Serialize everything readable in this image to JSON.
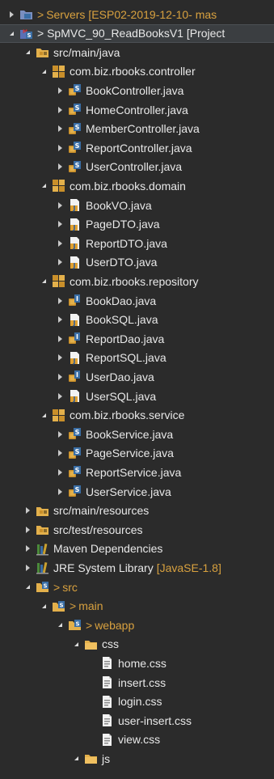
{
  "tree": [
    {
      "name": "servers-node",
      "depth": 0,
      "state": "closed",
      "icon": "project-folder-icon",
      "prefix": ">",
      "label": "Servers",
      "decoration": "[ESP02-2019-12-10- mas"
    },
    {
      "name": "project-node",
      "depth": 0,
      "state": "open",
      "icon": "maven-project-icon",
      "prefix": "",
      "label": "> SpMVC_90_ReadBooksV1 [Project",
      "decoration": "",
      "selected": true
    },
    {
      "name": "src-main-java",
      "depth": 1,
      "state": "open",
      "icon": "source-folder-icon",
      "prefix": "",
      "label": "src/main/java",
      "decoration": ""
    },
    {
      "name": "pkg-controller",
      "depth": 2,
      "state": "open",
      "icon": "package-icon",
      "prefix": "",
      "label": "com.biz.rbooks.controller",
      "decoration": ""
    },
    {
      "name": "file-bookcontroller",
      "depth": 3,
      "state": "closed",
      "icon": "java-class-icon",
      "prefix": "",
      "label": "BookController.java",
      "decoration": ""
    },
    {
      "name": "file-homecontroller",
      "depth": 3,
      "state": "closed",
      "icon": "java-class-icon",
      "prefix": "",
      "label": "HomeController.java",
      "decoration": ""
    },
    {
      "name": "file-membercontroller",
      "depth": 3,
      "state": "closed",
      "icon": "java-class-icon",
      "prefix": "",
      "label": "MemberController.java",
      "decoration": ""
    },
    {
      "name": "file-reportcontroller",
      "depth": 3,
      "state": "closed",
      "icon": "java-class-icon",
      "prefix": "",
      "label": "ReportController.java",
      "decoration": ""
    },
    {
      "name": "file-usercontroller",
      "depth": 3,
      "state": "closed",
      "icon": "java-class-icon",
      "prefix": "",
      "label": "UserController.java",
      "decoration": ""
    },
    {
      "name": "pkg-domain",
      "depth": 2,
      "state": "open",
      "icon": "package-icon",
      "prefix": "",
      "label": "com.biz.rbooks.domain",
      "decoration": ""
    },
    {
      "name": "file-bookvo",
      "depth": 3,
      "state": "closed",
      "icon": "java-file-icon",
      "prefix": "",
      "label": "BookVO.java",
      "decoration": ""
    },
    {
      "name": "file-pagedto",
      "depth": 3,
      "state": "closed",
      "icon": "java-file-icon",
      "prefix": "",
      "label": "PageDTO.java",
      "decoration": ""
    },
    {
      "name": "file-reportdto",
      "depth": 3,
      "state": "closed",
      "icon": "java-file-icon",
      "prefix": "",
      "label": "ReportDTO.java",
      "decoration": ""
    },
    {
      "name": "file-userdto",
      "depth": 3,
      "state": "closed",
      "icon": "java-file-icon",
      "prefix": "",
      "label": "UserDTO.java",
      "decoration": ""
    },
    {
      "name": "pkg-repository",
      "depth": 2,
      "state": "open",
      "icon": "package-icon",
      "prefix": "",
      "label": "com.biz.rbooks.repository",
      "decoration": ""
    },
    {
      "name": "file-bookdao",
      "depth": 3,
      "state": "closed",
      "icon": "java-interface-icon",
      "prefix": "",
      "label": "BookDao.java",
      "decoration": ""
    },
    {
      "name": "file-booksql",
      "depth": 3,
      "state": "closed",
      "icon": "java-file-icon",
      "prefix": "",
      "label": "BookSQL.java",
      "decoration": ""
    },
    {
      "name": "file-reportdao",
      "depth": 3,
      "state": "closed",
      "icon": "java-interface-icon",
      "prefix": "",
      "label": "ReportDao.java",
      "decoration": ""
    },
    {
      "name": "file-reportsql",
      "depth": 3,
      "state": "closed",
      "icon": "java-file-icon",
      "prefix": "",
      "label": "ReportSQL.java",
      "decoration": ""
    },
    {
      "name": "file-userdao",
      "depth": 3,
      "state": "closed",
      "icon": "java-interface-icon",
      "prefix": "",
      "label": "UserDao.java",
      "decoration": ""
    },
    {
      "name": "file-usersql",
      "depth": 3,
      "state": "closed",
      "icon": "java-file-icon",
      "prefix": "",
      "label": "UserSQL.java",
      "decoration": ""
    },
    {
      "name": "pkg-service",
      "depth": 2,
      "state": "open",
      "icon": "package-icon",
      "prefix": "",
      "label": "com.biz.rbooks.service",
      "decoration": ""
    },
    {
      "name": "file-bookservice",
      "depth": 3,
      "state": "closed",
      "icon": "java-class-icon",
      "prefix": "",
      "label": "BookService.java",
      "decoration": ""
    },
    {
      "name": "file-pageservice",
      "depth": 3,
      "state": "closed",
      "icon": "java-class-icon",
      "prefix": "",
      "label": "PageService.java",
      "decoration": ""
    },
    {
      "name": "file-reportservice",
      "depth": 3,
      "state": "closed",
      "icon": "java-class-icon",
      "prefix": "",
      "label": "ReportService.java",
      "decoration": ""
    },
    {
      "name": "file-userservice",
      "depth": 3,
      "state": "closed",
      "icon": "java-class-icon",
      "prefix": "",
      "label": "UserService.java",
      "decoration": ""
    },
    {
      "name": "src-main-resources",
      "depth": 1,
      "state": "closed",
      "icon": "source-folder-icon",
      "prefix": "",
      "label": "src/main/resources",
      "decoration": ""
    },
    {
      "name": "src-test-resources",
      "depth": 1,
      "state": "closed",
      "icon": "source-folder-icon",
      "prefix": "",
      "label": "src/test/resources",
      "decoration": ""
    },
    {
      "name": "maven-dependencies",
      "depth": 1,
      "state": "closed",
      "icon": "library-icon",
      "prefix": "",
      "label": "Maven Dependencies",
      "decoration": ""
    },
    {
      "name": "jre-system-library",
      "depth": 1,
      "state": "closed",
      "icon": "library-icon",
      "prefix": "",
      "label": "JRE System Library",
      "decoration": "[JavaSE-1.8]"
    },
    {
      "name": "folder-src",
      "depth": 1,
      "state": "open",
      "icon": "folder-modified-icon",
      "prefix": ">",
      "label": "src",
      "decoration": ""
    },
    {
      "name": "folder-main",
      "depth": 2,
      "state": "open",
      "icon": "folder-modified-icon",
      "prefix": ">",
      "label": "main",
      "decoration": ""
    },
    {
      "name": "folder-webapp",
      "depth": 3,
      "state": "open",
      "icon": "folder-modified-icon",
      "prefix": ">",
      "label": "webapp",
      "decoration": ""
    },
    {
      "name": "folder-css",
      "depth": 4,
      "state": "open",
      "icon": "folder-icon",
      "prefix": "",
      "label": "css",
      "decoration": ""
    },
    {
      "name": "file-home-css",
      "depth": 5,
      "state": "none",
      "icon": "css-file-icon",
      "prefix": "",
      "label": "home.css",
      "decoration": ""
    },
    {
      "name": "file-insert-css",
      "depth": 5,
      "state": "none",
      "icon": "css-file-icon",
      "prefix": "",
      "label": "insert.css",
      "decoration": ""
    },
    {
      "name": "file-login-css",
      "depth": 5,
      "state": "none",
      "icon": "css-file-icon",
      "prefix": "",
      "label": "login.css",
      "decoration": ""
    },
    {
      "name": "file-user-insert-css",
      "depth": 5,
      "state": "none",
      "icon": "css-file-icon",
      "prefix": "",
      "label": "user-insert.css",
      "decoration": ""
    },
    {
      "name": "file-view-css",
      "depth": 5,
      "state": "none",
      "icon": "css-file-icon",
      "prefix": "",
      "label": "view.css",
      "decoration": ""
    },
    {
      "name": "folder-js",
      "depth": 4,
      "state": "open",
      "icon": "folder-icon",
      "prefix": "",
      "label": "js",
      "decoration": ""
    }
  ],
  "colors": {
    "background": "#2b2b2b",
    "text": "#e8e8e8",
    "decoration": "#d8a13f",
    "selection": "#3b3e41"
  }
}
